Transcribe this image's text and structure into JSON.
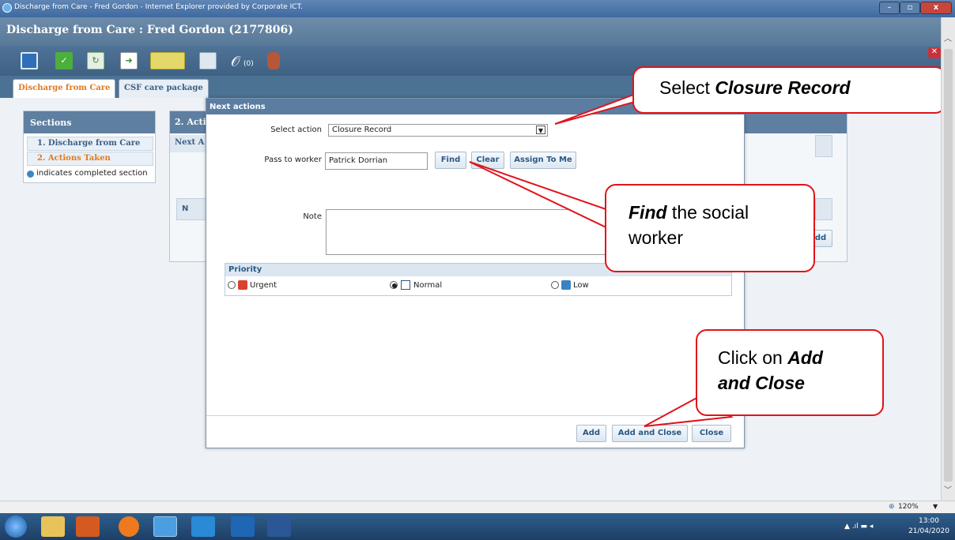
{
  "window": {
    "title": "Discharge from Care - Fred Gordon - Internet Explorer provided by Corporate ICT."
  },
  "app": {
    "header": "Discharge from Care :  Fred Gordon  (2177806)",
    "attachments_count": "(0)"
  },
  "tabs": [
    {
      "label": "Discharge from Care"
    },
    {
      "label": "CSF care package"
    }
  ],
  "sections": {
    "title": "Sections",
    "items": [
      {
        "label": "1.  Discharge from Care"
      },
      {
        "label": "2.  Actions Taken"
      }
    ],
    "legend": "indicates completed section"
  },
  "background_panel": {
    "title": "2. Acti",
    "subtitle": "Next A",
    "col": "N",
    "add_fragment": "dd"
  },
  "modal": {
    "title": "Next actions",
    "select_action_label": "Select action",
    "select_action_value": "Closure Record",
    "pass_to_worker_label": "Pass to worker",
    "pass_to_worker_value": "Patrick Dorrian",
    "find": "Find",
    "clear": "Clear",
    "assign_to_me": "Assign To Me",
    "note_label": "Note",
    "priority_label": "Priority",
    "priorities": [
      {
        "label": "Urgent",
        "selected": false
      },
      {
        "label": "Normal",
        "selected": true
      },
      {
        "label": "Low",
        "selected": false
      }
    ],
    "add": "Add",
    "add_and_close": "Add and Close",
    "close": "Close"
  },
  "callouts": {
    "select": {
      "pre": "Select ",
      "bold": "Closure Record"
    },
    "find": {
      "bold": "Find",
      "post": " the social",
      "line2": "worker"
    },
    "click": {
      "pre": "Click on ",
      "bold1": "Add",
      "bold2": "and Close"
    }
  },
  "status": {
    "zoom": "120%"
  },
  "taskbar": {
    "time": "13:00",
    "date": "21/04/2020"
  },
  "colors": {
    "header": "#577997",
    "callout_border": "#e0141b",
    "tab_active": "#e07b1e"
  }
}
